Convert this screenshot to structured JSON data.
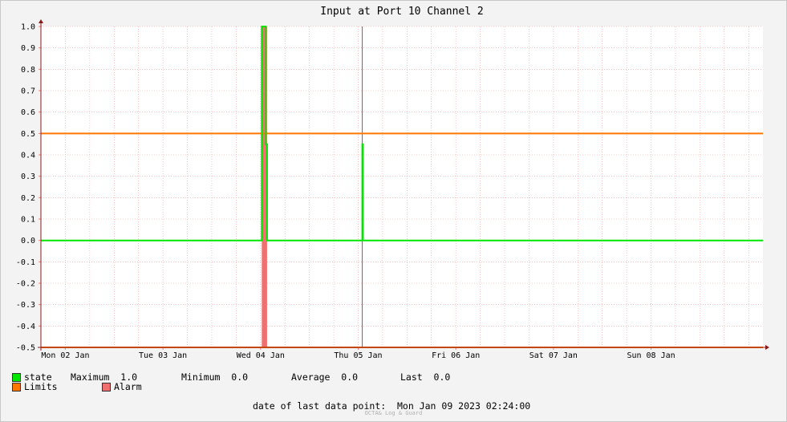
{
  "chart_data": {
    "type": "line",
    "title": "Input at Port 10 Channel 2",
    "ylim": [
      -0.5,
      1.0
    ],
    "y_ticks": [
      1.0,
      0.9,
      0.8,
      0.7,
      0.6,
      0.5,
      0.4,
      0.3,
      0.2,
      0.1,
      0.0,
      -0.1,
      -0.2,
      -0.3,
      -0.4,
      -0.5
    ],
    "y_tick_labels": [
      "1.0",
      "0.9",
      "0.8",
      "0.7",
      "0.6",
      "0.5",
      "0.4",
      "0.3",
      "0.2",
      "0.1",
      "0.0",
      "-0.1",
      "-0.2",
      "-0.3",
      "-0.4",
      "-0.5"
    ],
    "x_unit": "hours since 2023-01-01 18:00",
    "xlim": [
      0,
      177.5
    ],
    "x_ticks": [
      {
        "label": "Mon 02 Jan",
        "x": 6
      },
      {
        "label": "Tue 03 Jan",
        "x": 30
      },
      {
        "label": "Wed 04 Jan",
        "x": 54
      },
      {
        "label": "Thu 05 Jan",
        "x": 78
      },
      {
        "label": "Fri 06 Jan",
        "x": 102
      },
      {
        "label": "Sat 07 Jan",
        "x": 126
      },
      {
        "label": "Sun 08 Jan",
        "x": 150
      }
    ],
    "series": [
      {
        "name": "state",
        "color": "#00e600",
        "points": [
          [
            0,
            0
          ],
          [
            54.3,
            0
          ],
          [
            54.3,
            1.0
          ],
          [
            55.3,
            1.0
          ],
          [
            55.3,
            0.45
          ],
          [
            55.6,
            0.45
          ],
          [
            55.6,
            0
          ],
          [
            79,
            0
          ],
          [
            79,
            0.45
          ],
          [
            79.15,
            0.45
          ],
          [
            79.15,
            0
          ],
          [
            177.5,
            0
          ]
        ]
      },
      {
        "name": "Limits",
        "color": "#ff7700",
        "values": [
          0.5,
          -0.5
        ]
      },
      {
        "name": "Alarm",
        "color": "#f07070",
        "spans": [
          [
            54.3,
            55.6
          ]
        ]
      }
    ],
    "marker_x": 79,
    "grid": true
  },
  "legend": {
    "state_label": "state",
    "maximum": "Maximum  1.0",
    "minimum": "Minimum  0.0",
    "average": "Average  0.0",
    "last": "Last  0.0",
    "limits_label": "Limits",
    "alarm_label": "Alarm"
  },
  "footer": {
    "last_point": "date of last data point:  Mon Jan 09 2023 02:24:00",
    "credit": "OCTA& Log & Guard"
  }
}
